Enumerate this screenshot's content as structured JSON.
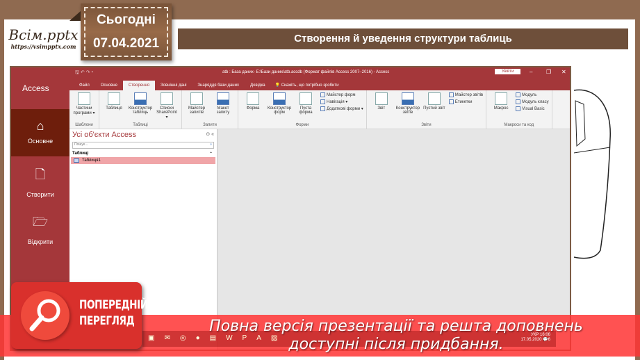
{
  "slide": {
    "brand_name": "Всім.pptx",
    "brand_url": "https://vsimpptx.com",
    "date_label": "Сьогодні",
    "date_value": "07.04.2021",
    "title": "Створення й уведення структури таблиць"
  },
  "backstage": {
    "title": "Access",
    "items": [
      {
        "label": "Основне",
        "icon": "home-icon",
        "active": true
      },
      {
        "label": "Створити",
        "icon": "new-document-icon",
        "active": false
      },
      {
        "label": "Відкрити",
        "icon": "folder-open-icon",
        "active": false
      }
    ]
  },
  "access": {
    "window_title": "atb : База даних- E:\\Бази даних\\atb.accdb (Формат файлів Access 2007–2016) - Access",
    "sign_in": "Увійти",
    "controls": {
      "minimize": "–",
      "restore": "❐",
      "close": "✕"
    },
    "tabs": [
      "Файл",
      "Основне",
      "Створення",
      "Зовнішні дані",
      "Знаряддя бази даних",
      "Довідка"
    ],
    "active_tab": "Створення",
    "tell_me": "Скажіть, що потрібно зробити",
    "ribbon": {
      "templates": {
        "label": "Шаблони",
        "buttons": [
          "Частини програми ▾"
        ]
      },
      "tables": {
        "label": "Таблиці",
        "buttons": [
          "Таблиця",
          "Конструктор таблиць",
          "Списки SharePoint ▾"
        ]
      },
      "queries": {
        "label": "Запити",
        "buttons": [
          "Майстер запитів",
          "Макет запиту"
        ]
      },
      "forms": {
        "label": "Форми",
        "buttons": [
          "Форма",
          "Конструктор форм",
          "Пуста форма"
        ],
        "small": [
          "Майстер форм",
          "Навігація ▾",
          "Додаткові форми ▾"
        ]
      },
      "reports": {
        "label": "Звіти",
        "buttons": [
          "Звіт",
          "Конструктор звітів",
          "Пустий звіт"
        ],
        "small": [
          "Майстер звітів",
          "Етикетки"
        ]
      },
      "macros": {
        "label": "Макроси та код",
        "buttons": [
          "Макрос"
        ],
        "small": [
          "Модуль",
          "Модуль класу",
          "Visual Basic"
        ]
      }
    },
    "nav": {
      "title": "Усі об'єкти Access",
      "search_placeholder": "Пошук...",
      "group": "Таблиці",
      "items": [
        "Таблиця1"
      ]
    }
  },
  "taskbar": {
    "icons": [
      "store-icon",
      "mail-icon",
      "viber-icon",
      "chrome-icon",
      "media-icon",
      "word-icon",
      "powerpoint-icon",
      "access-icon",
      "photos-icon"
    ],
    "tray_lang": "УКР",
    "time": "16:06",
    "date": "17.05.2020",
    "notifications": "6"
  },
  "overlay": {
    "preview_line1": "ПОПЕРЕДНІЙ",
    "preview_line2": "ПЕРЕГЛЯД",
    "banner_line1": "Повна версія презентації та решта доповнень",
    "banner_line2": "доступні після придбання."
  }
}
